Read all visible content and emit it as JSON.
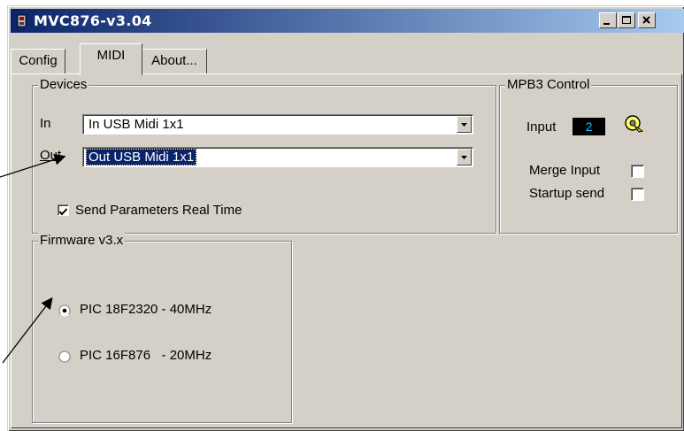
{
  "window": {
    "title": "MVC876-v3.04",
    "controls": [
      "minimize",
      "maximize",
      "close"
    ]
  },
  "tabs": [
    {
      "label": "Config",
      "active": false
    },
    {
      "label": "MIDI",
      "active": true
    },
    {
      "label": "About...",
      "active": false
    }
  ],
  "devices": {
    "legend": "Devices",
    "in_label": "In",
    "in_value": "In USB Midi 1x1",
    "out_label": "Out",
    "out_value": "Out USB Midi 1x1",
    "send_realtime_label": "Send Parameters Real Time",
    "send_realtime_checked": true
  },
  "mpb3": {
    "legend": "MPB3 Control",
    "input_label": "Input",
    "input_value": "2",
    "merge_label": "Merge Input",
    "merge_checked": false,
    "startup_label": "Startup send",
    "startup_checked": false
  },
  "firmware": {
    "legend": "Firmware v3.x",
    "options": [
      {
        "label": "PIC 18F2320 - 40MHz",
        "selected": true
      },
      {
        "label": "PIC 16F876   - 20MHz",
        "selected": false
      }
    ]
  },
  "colors": {
    "face": "#d4d0c8",
    "title_start": "#0a246a",
    "title_end": "#a6caf0",
    "selection": "#0a246a",
    "display_bg": "#000000",
    "display_fg": "#00c8ff"
  },
  "icons": {
    "app": "app-icon",
    "knob": "knob-icon"
  }
}
